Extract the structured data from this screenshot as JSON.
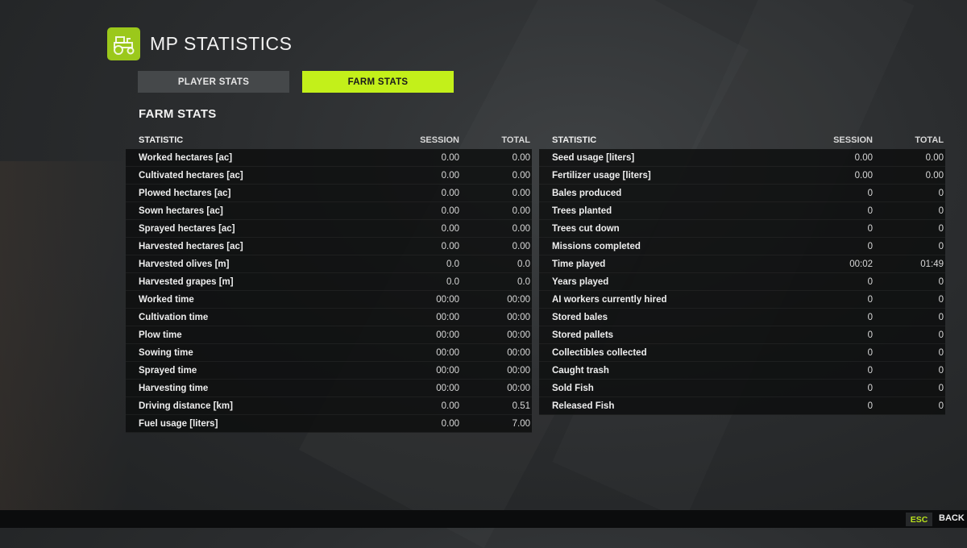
{
  "header": {
    "title": "MP STATISTICS",
    "icon": "tractor-icon"
  },
  "tabs": {
    "player": "PLAYER STATS",
    "farm": "FARM STATS"
  },
  "section_title": "FARM STATS",
  "colors": {
    "accent": "#c3f01a",
    "logo_bg": "#9bc81b"
  },
  "left_table": {
    "headers": {
      "statistic": "STATISTIC",
      "session": "SESSION",
      "total": "TOTAL"
    },
    "rows": [
      {
        "name": "Worked hectares [ac]",
        "session": "0.00",
        "total": "0.00"
      },
      {
        "name": "Cultivated hectares [ac]",
        "session": "0.00",
        "total": "0.00"
      },
      {
        "name": "Plowed hectares [ac]",
        "session": "0.00",
        "total": "0.00"
      },
      {
        "name": "Sown hectares [ac]",
        "session": "0.00",
        "total": "0.00"
      },
      {
        "name": "Sprayed hectares [ac]",
        "session": "0.00",
        "total": "0.00"
      },
      {
        "name": "Harvested hectares [ac]",
        "session": "0.00",
        "total": "0.00"
      },
      {
        "name": "Harvested olives [m]",
        "session": "0.0",
        "total": "0.0"
      },
      {
        "name": "Harvested grapes [m]",
        "session": "0.0",
        "total": "0.0"
      },
      {
        "name": "Worked time",
        "session": "00:00",
        "total": "00:00"
      },
      {
        "name": "Cultivation time",
        "session": "00:00",
        "total": "00:00"
      },
      {
        "name": "Plow time",
        "session": "00:00",
        "total": "00:00"
      },
      {
        "name": "Sowing time",
        "session": "00:00",
        "total": "00:00"
      },
      {
        "name": "Sprayed time",
        "session": "00:00",
        "total": "00:00"
      },
      {
        "name": "Harvesting time",
        "session": "00:00",
        "total": "00:00"
      },
      {
        "name": "Driving distance [km]",
        "session": "0.00",
        "total": "0.51"
      },
      {
        "name": "Fuel usage [liters]",
        "session": "0.00",
        "total": "7.00"
      }
    ]
  },
  "right_table": {
    "headers": {
      "statistic": "STATISTIC",
      "session": "SESSION",
      "total": "TOTAL"
    },
    "rows": [
      {
        "name": "Seed usage [liters]",
        "session": "0.00",
        "total": "0.00"
      },
      {
        "name": "Fertilizer usage [liters]",
        "session": "0.00",
        "total": "0.00"
      },
      {
        "name": "Bales produced",
        "session": "0",
        "total": "0"
      },
      {
        "name": "Trees planted",
        "session": "0",
        "total": "0"
      },
      {
        "name": "Trees cut down",
        "session": "0",
        "total": "0"
      },
      {
        "name": "Missions completed",
        "session": "0",
        "total": "0"
      },
      {
        "name": "Time played",
        "session": "00:02",
        "total": "01:49"
      },
      {
        "name": "Years played",
        "session": "0",
        "total": "0"
      },
      {
        "name": "AI workers currently hired",
        "session": "0",
        "total": "0"
      },
      {
        "name": "Stored bales",
        "session": "0",
        "total": "0"
      },
      {
        "name": "Stored pallets",
        "session": "0",
        "total": "0"
      },
      {
        "name": "Collectibles collected",
        "session": "0",
        "total": "0"
      },
      {
        "name": "Caught trash",
        "session": "0",
        "total": "0"
      },
      {
        "name": "Sold Fish",
        "session": "0",
        "total": "0"
      },
      {
        "name": "Released Fish",
        "session": "0",
        "total": "0"
      }
    ]
  },
  "footer": {
    "esc_key": "ESC",
    "back_label": "BACK"
  }
}
